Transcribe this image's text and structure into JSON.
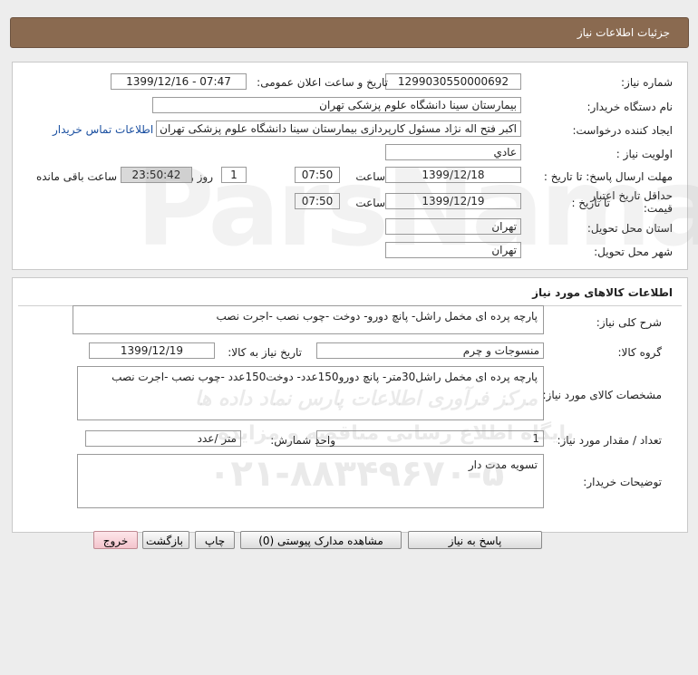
{
  "header": {
    "title": "جزئیات اطلاعات نیاز"
  },
  "details": {
    "need_number_label": "شماره نیاز:",
    "need_number": "1299030550000692",
    "announce_label": "تاریخ و ساعت اعلان عمومی:",
    "announce_value": "1399/12/16 - 07:47",
    "buyer_org_label": "نام دستگاه خریدار:",
    "buyer_org": "بیمارستان سینا دانشگاه علوم پزشکی تهران",
    "requester_label": "ایجاد کننده درخواست:",
    "requester": "اکبر  فتح اله نژاد  مسئول کارپردازی  بیمارستان سینا دانشگاه علوم پزشکی تهران",
    "contact_link": "اطلاعات تماس خریدار",
    "priority_label": "اولویت نیاز :",
    "priority": "عادي",
    "deadline_label": "مهلت ارسال پاسخ: تا تاریخ :",
    "deadline_date": "1399/12/18",
    "time_label": "ساعت",
    "deadline_time": "07:50",
    "day_count": "1",
    "day_label": "روز و",
    "remaining": "23:50:42",
    "remaining_label": "ساعت باقی مانده",
    "validity_label": "حداقل تاریخ اعتبار قیمت:",
    "validity_to_label": "تا تاریخ :",
    "validity_date": "1399/12/19",
    "validity_time": "07:50",
    "province_label": "استان محل تحویل:",
    "province": "تهران",
    "city_label": "شهر محل تحویل:",
    "city": "تهران"
  },
  "goods": {
    "section_title": "اطلاعات کالاهای مورد نیاز",
    "summary_label": "شرح کلی نیاز:",
    "summary": "پارچه پرده ای مخمل راشل- پانچ دورو- دوخت -چوب نصب -اجرت نصب",
    "group_label": "گروه کالا:",
    "group": "منسوجات و چرم",
    "need_date_label": "تاریخ نیاز به کالا:",
    "need_date": "1399/12/19",
    "specs_label": "مشخصات کالای مورد نیاز:",
    "specs": "پارچه پرده ای مخمل راشل30متر- پانچ دورو150عدد- دوخت150عدد -چوب نصب -اجرت نصب",
    "qty_label": "تعداد / مقدار مورد نیاز:",
    "qty": "1",
    "unit_label": "واحد شمارش:",
    "unit": "متر /عدد",
    "buyer_notes_label": "توضیحات خریدار:",
    "buyer_notes": "تسویه مدت دار"
  },
  "buttons": {
    "reply": "پاسخ به نیاز",
    "attachments": "مشاهده مدارک پیوستی (0)",
    "print": "چاپ",
    "back": "بازگشت",
    "exit": "خروج"
  },
  "watermark": {
    "line1": "مرکز فرآوری اطلاعات پارس نماد داده ها",
    "line2": "پایگاه اطلاع رسانی مناقصه و مزایده",
    "phone": "۰۲۱-۸۸۳۴۹۶۷۰-۵",
    "brand": "ParsNamadData"
  }
}
